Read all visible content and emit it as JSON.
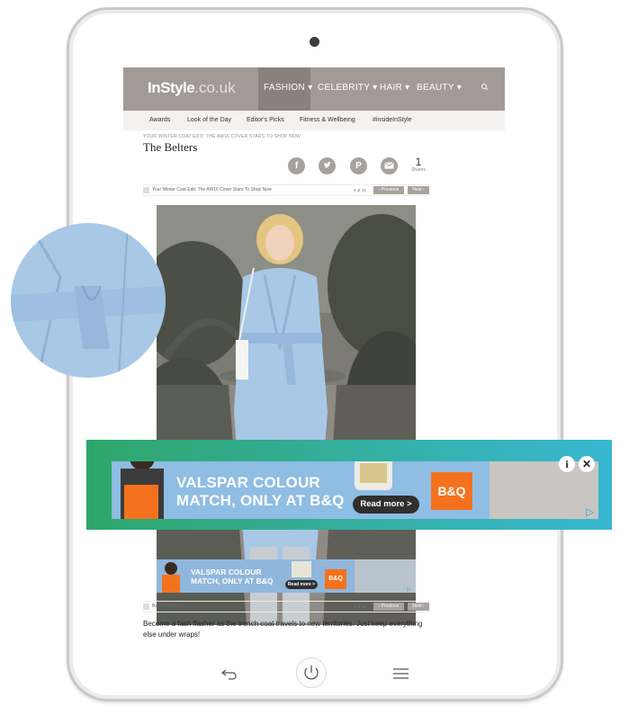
{
  "site": {
    "logo_bold": "InStyle",
    "logo_light": ".co.uk",
    "nav": [
      "FASHION",
      "CELEBRITY",
      "HAIR",
      "BEAUTY"
    ],
    "subnav": [
      "Awards",
      "Look of the Day",
      "Editor's Picks",
      "Fitness & Wellbeing",
      "#insideInStyle"
    ]
  },
  "article": {
    "kicker": "YOUR WINTER COAT EDIT: THE AW16 COVER STARS TO SHOP NOW",
    "title": "The Belters",
    "share_count": "1",
    "share_label": "Shares",
    "share_icons": [
      "facebook-icon",
      "twitter-icon",
      "pinterest-icon",
      "email-icon"
    ],
    "top_bar_text": "Your Winter Coat Edit: The AW16 Cover Stars To Shop Now",
    "counter": "8 of 15",
    "previous": "‹ Previous",
    "next": "Next ›",
    "back_to_gallery": "Back to gallery",
    "description": "Become a fash flasher as the trench coat travels to new territories. Just keep everything else under wraps!"
  },
  "ad": {
    "line1": "VALSPAR COLOUR",
    "line2": "MATCH, ONLY AT B&Q",
    "read_more": "Read more >",
    "brand": "B&Q",
    "info": "i",
    "close": "✕"
  },
  "colors": {
    "header": "#a39a96",
    "brand_orange": "#f4721d",
    "coat_blue": "#a9c8e6",
    "ad_teal": "#32b8c8",
    "ad_green": "#2ea66a"
  }
}
